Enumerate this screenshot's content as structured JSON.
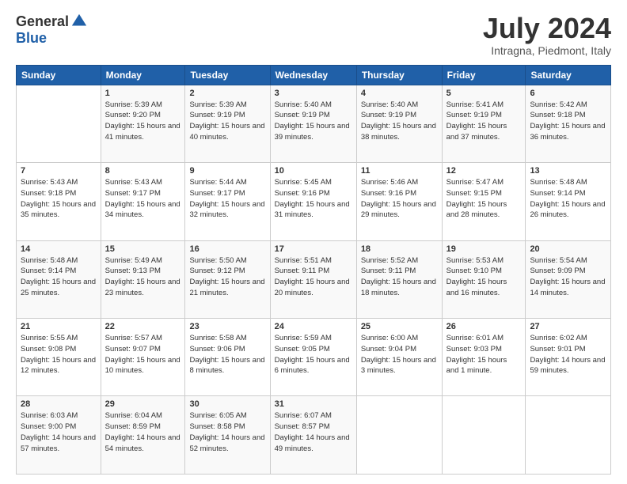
{
  "header": {
    "logo_line1": "General",
    "logo_line2": "Blue",
    "month_title": "July 2024",
    "location": "Intragna, Piedmont, Italy"
  },
  "weekdays": [
    "Sunday",
    "Monday",
    "Tuesday",
    "Wednesday",
    "Thursday",
    "Friday",
    "Saturday"
  ],
  "weeks": [
    [
      {
        "day": "",
        "sunrise": "",
        "sunset": "",
        "daylight": ""
      },
      {
        "day": "1",
        "sunrise": "Sunrise: 5:39 AM",
        "sunset": "Sunset: 9:20 PM",
        "daylight": "Daylight: 15 hours and 41 minutes."
      },
      {
        "day": "2",
        "sunrise": "Sunrise: 5:39 AM",
        "sunset": "Sunset: 9:19 PM",
        "daylight": "Daylight: 15 hours and 40 minutes."
      },
      {
        "day": "3",
        "sunrise": "Sunrise: 5:40 AM",
        "sunset": "Sunset: 9:19 PM",
        "daylight": "Daylight: 15 hours and 39 minutes."
      },
      {
        "day": "4",
        "sunrise": "Sunrise: 5:40 AM",
        "sunset": "Sunset: 9:19 PM",
        "daylight": "Daylight: 15 hours and 38 minutes."
      },
      {
        "day": "5",
        "sunrise": "Sunrise: 5:41 AM",
        "sunset": "Sunset: 9:19 PM",
        "daylight": "Daylight: 15 hours and 37 minutes."
      },
      {
        "day": "6",
        "sunrise": "Sunrise: 5:42 AM",
        "sunset": "Sunset: 9:18 PM",
        "daylight": "Daylight: 15 hours and 36 minutes."
      }
    ],
    [
      {
        "day": "7",
        "sunrise": "Sunrise: 5:43 AM",
        "sunset": "Sunset: 9:18 PM",
        "daylight": "Daylight: 15 hours and 35 minutes."
      },
      {
        "day": "8",
        "sunrise": "Sunrise: 5:43 AM",
        "sunset": "Sunset: 9:17 PM",
        "daylight": "Daylight: 15 hours and 34 minutes."
      },
      {
        "day": "9",
        "sunrise": "Sunrise: 5:44 AM",
        "sunset": "Sunset: 9:17 PM",
        "daylight": "Daylight: 15 hours and 32 minutes."
      },
      {
        "day": "10",
        "sunrise": "Sunrise: 5:45 AM",
        "sunset": "Sunset: 9:16 PM",
        "daylight": "Daylight: 15 hours and 31 minutes."
      },
      {
        "day": "11",
        "sunrise": "Sunrise: 5:46 AM",
        "sunset": "Sunset: 9:16 PM",
        "daylight": "Daylight: 15 hours and 29 minutes."
      },
      {
        "day": "12",
        "sunrise": "Sunrise: 5:47 AM",
        "sunset": "Sunset: 9:15 PM",
        "daylight": "Daylight: 15 hours and 28 minutes."
      },
      {
        "day": "13",
        "sunrise": "Sunrise: 5:48 AM",
        "sunset": "Sunset: 9:14 PM",
        "daylight": "Daylight: 15 hours and 26 minutes."
      }
    ],
    [
      {
        "day": "14",
        "sunrise": "Sunrise: 5:48 AM",
        "sunset": "Sunset: 9:14 PM",
        "daylight": "Daylight: 15 hours and 25 minutes."
      },
      {
        "day": "15",
        "sunrise": "Sunrise: 5:49 AM",
        "sunset": "Sunset: 9:13 PM",
        "daylight": "Daylight: 15 hours and 23 minutes."
      },
      {
        "day": "16",
        "sunrise": "Sunrise: 5:50 AM",
        "sunset": "Sunset: 9:12 PM",
        "daylight": "Daylight: 15 hours and 21 minutes."
      },
      {
        "day": "17",
        "sunrise": "Sunrise: 5:51 AM",
        "sunset": "Sunset: 9:11 PM",
        "daylight": "Daylight: 15 hours and 20 minutes."
      },
      {
        "day": "18",
        "sunrise": "Sunrise: 5:52 AM",
        "sunset": "Sunset: 9:11 PM",
        "daylight": "Daylight: 15 hours and 18 minutes."
      },
      {
        "day": "19",
        "sunrise": "Sunrise: 5:53 AM",
        "sunset": "Sunset: 9:10 PM",
        "daylight": "Daylight: 15 hours and 16 minutes."
      },
      {
        "day": "20",
        "sunrise": "Sunrise: 5:54 AM",
        "sunset": "Sunset: 9:09 PM",
        "daylight": "Daylight: 15 hours and 14 minutes."
      }
    ],
    [
      {
        "day": "21",
        "sunrise": "Sunrise: 5:55 AM",
        "sunset": "Sunset: 9:08 PM",
        "daylight": "Daylight: 15 hours and 12 minutes."
      },
      {
        "day": "22",
        "sunrise": "Sunrise: 5:57 AM",
        "sunset": "Sunset: 9:07 PM",
        "daylight": "Daylight: 15 hours and 10 minutes."
      },
      {
        "day": "23",
        "sunrise": "Sunrise: 5:58 AM",
        "sunset": "Sunset: 9:06 PM",
        "daylight": "Daylight: 15 hours and 8 minutes."
      },
      {
        "day": "24",
        "sunrise": "Sunrise: 5:59 AM",
        "sunset": "Sunset: 9:05 PM",
        "daylight": "Daylight: 15 hours and 6 minutes."
      },
      {
        "day": "25",
        "sunrise": "Sunrise: 6:00 AM",
        "sunset": "Sunset: 9:04 PM",
        "daylight": "Daylight: 15 hours and 3 minutes."
      },
      {
        "day": "26",
        "sunrise": "Sunrise: 6:01 AM",
        "sunset": "Sunset: 9:03 PM",
        "daylight": "Daylight: 15 hours and 1 minute."
      },
      {
        "day": "27",
        "sunrise": "Sunrise: 6:02 AM",
        "sunset": "Sunset: 9:01 PM",
        "daylight": "Daylight: 14 hours and 59 minutes."
      }
    ],
    [
      {
        "day": "28",
        "sunrise": "Sunrise: 6:03 AM",
        "sunset": "Sunset: 9:00 PM",
        "daylight": "Daylight: 14 hours and 57 minutes."
      },
      {
        "day": "29",
        "sunrise": "Sunrise: 6:04 AM",
        "sunset": "Sunset: 8:59 PM",
        "daylight": "Daylight: 14 hours and 54 minutes."
      },
      {
        "day": "30",
        "sunrise": "Sunrise: 6:05 AM",
        "sunset": "Sunset: 8:58 PM",
        "daylight": "Daylight: 14 hours and 52 minutes."
      },
      {
        "day": "31",
        "sunrise": "Sunrise: 6:07 AM",
        "sunset": "Sunset: 8:57 PM",
        "daylight": "Daylight: 14 hours and 49 minutes."
      },
      {
        "day": "",
        "sunrise": "",
        "sunset": "",
        "daylight": ""
      },
      {
        "day": "",
        "sunrise": "",
        "sunset": "",
        "daylight": ""
      },
      {
        "day": "",
        "sunrise": "",
        "sunset": "",
        "daylight": ""
      }
    ]
  ]
}
